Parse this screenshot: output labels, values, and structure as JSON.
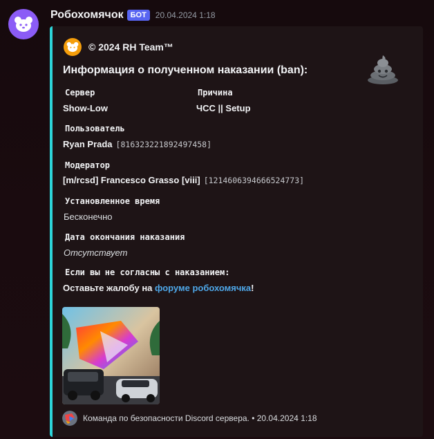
{
  "message": {
    "username": "Робохомячок",
    "bot_badge": "БОТ",
    "timestamp": "20.04.2024 1:18",
    "avatar_icon": "hamster-icon",
    "avatar_color": "#8b5cf6"
  },
  "embed": {
    "accent_color": "#2dd4d9",
    "author": "© 2024 RH Team™",
    "author_icon": "hamster-icon",
    "thumbnail_icon": "poop-icon",
    "title": "Информация о полученном наказании (ban):",
    "fields": {
      "server": {
        "name": "Сервер",
        "value": "Show-Low"
      },
      "reason": {
        "name": "Причина",
        "value": "ЧСС || Setup"
      },
      "user": {
        "name": "Пользователь",
        "value": "Ryan Prada",
        "id": "[816323221892497458]"
      },
      "moderator": {
        "name": "Модератор",
        "value": "[m/rcsd] Francesco Grasso [viii]",
        "id": "[1214606394666524773]"
      },
      "duration": {
        "name": "Установленное время",
        "value": "Бесконечно"
      },
      "end_date": {
        "name": "Дата окончания наказания",
        "value": "Отсутствует"
      },
      "appeal": {
        "name": "Если вы не согласны с наказанием:",
        "text_before": "Оставьте жалобу на ",
        "link": "форуме робохомячка",
        "text_after": "!"
      }
    },
    "image_icon": "cars-artwork-image",
    "footer": {
      "icon": "team-logo-icon",
      "text": "Команда по безопасности Discord сервера. • 20.04.2024 1:18"
    }
  }
}
